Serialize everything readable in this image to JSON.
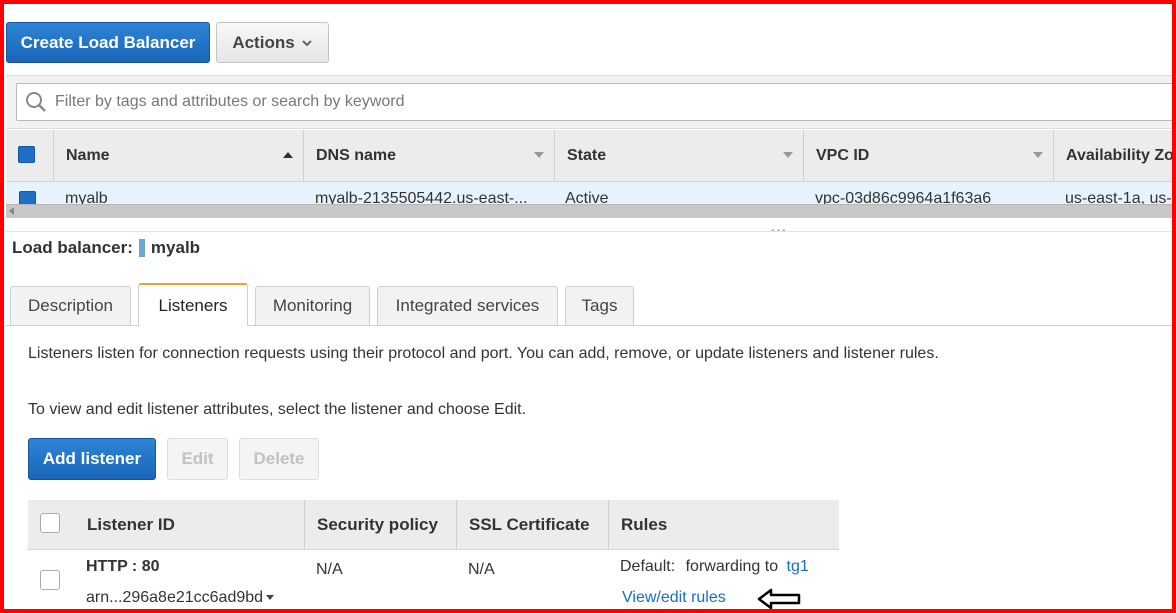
{
  "toolbar": {
    "create_label": "Create Load Balancer",
    "actions_label": "Actions"
  },
  "search": {
    "placeholder": "Filter by tags and attributes or search by keyword"
  },
  "lb_table": {
    "columns": [
      "Name",
      "DNS name",
      "State",
      "VPC ID",
      "Availability Zo"
    ],
    "row": {
      "name": "myalb",
      "dns": "myalb-2135505442.us-east-...",
      "state": "Active",
      "vpc": "vpc-03d86c9964a1f63a6",
      "az": "us-east-1a, us-"
    }
  },
  "detail": {
    "label": "Load balancer:",
    "name": "myalb",
    "tabs": [
      "Description",
      "Listeners",
      "Monitoring",
      "Integrated services",
      "Tags"
    ],
    "active_tab": "Listeners",
    "text1": "Listeners listen for connection requests using their protocol and port. You can add, remove, or update listeners and listener rules.",
    "text2": "To view and edit listener attributes, select the listener and choose Edit."
  },
  "listener_buttons": {
    "add": "Add listener",
    "edit": "Edit",
    "delete": "Delete"
  },
  "listener_table": {
    "columns": [
      "Listener ID",
      "Security policy",
      "SSL Certificate",
      "Rules"
    ],
    "row": {
      "protocol_port": "HTTP : 80",
      "arn": "arn...296a8e21cc6ad9bd",
      "security_policy": "N/A",
      "ssl": "N/A",
      "rules_default": "Default:",
      "rules_forward": "forwarding to",
      "rules_target": "tg1",
      "view_edit": "View/edit rules"
    }
  },
  "colors": {
    "primary": "#1a66b8",
    "frame": "#ff0000",
    "active_tab": "#e7a33a",
    "link": "#1a6cc4"
  }
}
